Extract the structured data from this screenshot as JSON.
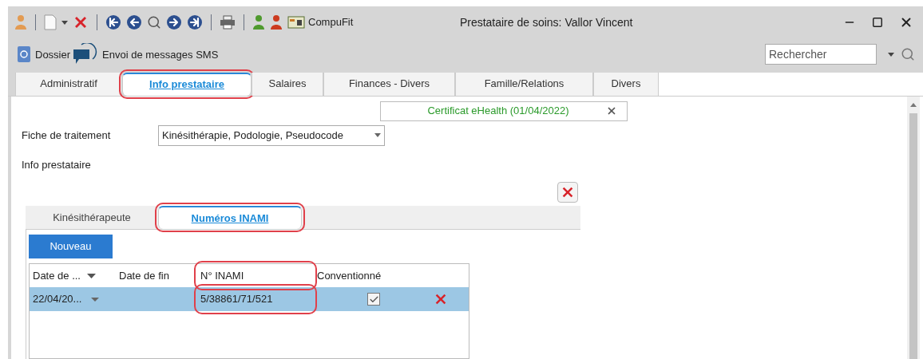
{
  "window": {
    "title": "Prestataire de soins: Vallor Vincent"
  },
  "toolbar": {
    "label": "CompuFit"
  },
  "actions": [
    {
      "kind": "folder",
      "label": "Dossier"
    },
    {
      "kind": "chat",
      "label": "Envoi de messages SMS"
    }
  ],
  "search": {
    "placeholder": "Rechercher"
  },
  "tabs": [
    {
      "label": "Administratif",
      "selected": false,
      "highlighted": false
    },
    {
      "label": "Info prestataire",
      "selected": true,
      "highlighted": true
    },
    {
      "label": "Salaires",
      "selected": false,
      "highlighted": false
    },
    {
      "label": "Finances - Divers",
      "selected": false,
      "highlighted": false
    },
    {
      "label": "Famille/Relations",
      "selected": false,
      "highlighted": false
    },
    {
      "label": "Divers",
      "selected": false,
      "highlighted": false
    }
  ],
  "certificate": {
    "text": "Certificat eHealth (01/04/2022)"
  },
  "treatment": {
    "label": "Fiche de traitement",
    "value": "Kinésithérapie, Podologie, Pseudocode"
  },
  "section_label": "Info prestataire",
  "sub_tabs": [
    {
      "label": "Kinésithérapeute",
      "selected": false,
      "highlighted": false
    },
    {
      "label": "Numéros INAMI",
      "selected": true,
      "highlighted": true
    }
  ],
  "new_button": "Nouveau",
  "table": {
    "columns": [
      {
        "label": "Date de ...",
        "filter": true,
        "highlighted": false
      },
      {
        "label": "Date de fin",
        "filter": false,
        "highlighted": false
      },
      {
        "label": "N° INAMI",
        "filter": false,
        "highlighted": true
      },
      {
        "label": "Conventionné",
        "filter": false,
        "highlighted": false
      }
    ],
    "rows": [
      {
        "start": "22/04/20...",
        "end": "",
        "inami": "5/38861/71/521",
        "conventionne": true,
        "selected": true
      }
    ]
  }
}
